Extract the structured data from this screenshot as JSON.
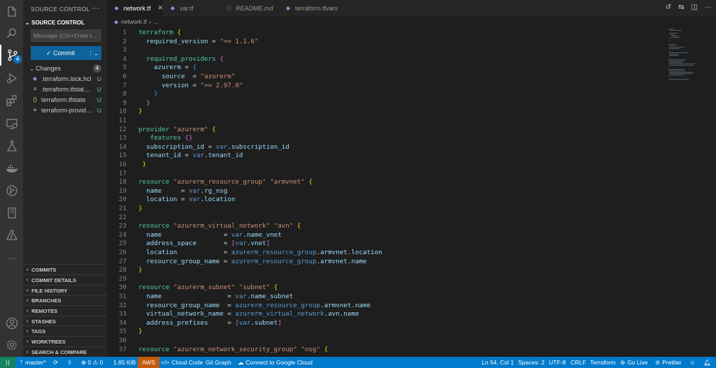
{
  "activity_bar": {
    "items": [
      {
        "name": "explorer",
        "icon": "files-icon"
      },
      {
        "name": "search",
        "icon": "search-icon"
      },
      {
        "name": "source-control",
        "icon": "source-control-icon",
        "badge": "4"
      },
      {
        "name": "run-debug",
        "icon": "run-debug-icon"
      },
      {
        "name": "extensions",
        "icon": "extensions-icon"
      },
      {
        "name": "remote-explorer",
        "icon": "remote-explorer-icon"
      },
      {
        "name": "testing",
        "icon": "flask-icon"
      },
      {
        "name": "docker",
        "icon": "docker-icon"
      },
      {
        "name": "git-graph",
        "icon": "git-graph-icon"
      },
      {
        "name": "notebook",
        "icon": "notebook-icon"
      },
      {
        "name": "azure",
        "icon": "azure-icon"
      },
      {
        "name": "more",
        "icon": "ellipsis-icon"
      }
    ],
    "bottom": [
      {
        "name": "accounts",
        "icon": "account-icon"
      },
      {
        "name": "manage",
        "icon": "gear-icon"
      }
    ]
  },
  "sidebar": {
    "title": "SOURCE CONTROL",
    "section": "SOURCE CONTROL",
    "message_placeholder": "Message (Ctrl+Enter t...",
    "commit_label": "✓ Commit",
    "changes_label": "Changes",
    "changes_count": "4",
    "files": [
      {
        "name": ".terraform.lock.hcl",
        "status": "U",
        "icon": "terraform-icon"
      },
      {
        "name": ".terraform.tfstate.l...",
        "status": "U",
        "icon": "file-icon"
      },
      {
        "name": "terraform.tfstate",
        "status": "U",
        "icon": "json-icon"
      },
      {
        "name": "terraform-provide...",
        "status": "U",
        "icon": "file-icon"
      }
    ],
    "panels": [
      "COMMITS",
      "COMMIT DETAILS",
      "FILE HISTORY",
      "BRANCHES",
      "REMOTES",
      "STASHES",
      "TAGS",
      "WORKTREES",
      "SEARCH & COMPARE"
    ]
  },
  "tabs": [
    {
      "label": "network.tf",
      "active": true,
      "icon": "terraform-icon"
    },
    {
      "label": "var.tf",
      "active": false,
      "icon": "terraform-icon"
    },
    {
      "label": "README.md",
      "active": false,
      "icon": "info-icon"
    },
    {
      "label": "terraform.tfvars",
      "active": false,
      "icon": "terraform-icon"
    }
  ],
  "breadcrumb": {
    "file": "network.tf",
    "rest": "..."
  },
  "editor": {
    "lines": [
      [
        [
          "kw",
          "terraform "
        ],
        [
          "br1",
          "{"
        ]
      ],
      [
        [
          "txt",
          "  "
        ],
        [
          "attr",
          "required_version"
        ],
        [
          "txt",
          " = "
        ],
        [
          "str",
          "\">= 1.1.6\""
        ]
      ],
      [
        [
          "txt",
          ""
        ]
      ],
      [
        [
          "txt",
          "  "
        ],
        [
          "kw",
          "required_providers "
        ],
        [
          "br2",
          "{"
        ]
      ],
      [
        [
          "txt",
          "    "
        ],
        [
          "attr",
          "azurerm"
        ],
        [
          "txt",
          " = "
        ],
        [
          "br3",
          "{"
        ]
      ],
      [
        [
          "txt",
          "      "
        ],
        [
          "attr",
          "source"
        ],
        [
          "txt",
          "  = "
        ],
        [
          "str",
          "\"azurerm\""
        ]
      ],
      [
        [
          "txt",
          "      "
        ],
        [
          "attr",
          "version"
        ],
        [
          "txt",
          " = "
        ],
        [
          "str",
          "\">= 2.97.0\""
        ]
      ],
      [
        [
          "txt",
          "    "
        ],
        [
          "br3",
          "}"
        ]
      ],
      [
        [
          "txt",
          "  "
        ],
        [
          "br2",
          "}"
        ]
      ],
      [
        [
          "br1",
          "}"
        ]
      ],
      [
        [
          "txt",
          ""
        ]
      ],
      [
        [
          "kw",
          "provider "
        ],
        [
          "str",
          "\"azurerm\" "
        ],
        [
          "br1",
          "{"
        ]
      ],
      [
        [
          "txt",
          "   "
        ],
        [
          "kw",
          "features "
        ],
        [
          "br2",
          "{}"
        ]
      ],
      [
        [
          "txt",
          "  "
        ],
        [
          "attr",
          "subscription_id"
        ],
        [
          "txt",
          " = "
        ],
        [
          "var",
          "var"
        ],
        [
          "txt",
          "."
        ],
        [
          "attr",
          "subscription_id"
        ]
      ],
      [
        [
          "txt",
          "  "
        ],
        [
          "attr",
          "tenant_id"
        ],
        [
          "txt",
          " = "
        ],
        [
          "var",
          "var"
        ],
        [
          "txt",
          "."
        ],
        [
          "attr",
          "tenant_id"
        ]
      ],
      [
        [
          "txt",
          " "
        ],
        [
          "br1",
          "}"
        ]
      ],
      [
        [
          "txt",
          ""
        ]
      ],
      [
        [
          "kw",
          "resource "
        ],
        [
          "str",
          "\"azurerm_resource_group\" \"armvnet\" "
        ],
        [
          "br1",
          "{"
        ]
      ],
      [
        [
          "txt",
          "  "
        ],
        [
          "attr",
          "name"
        ],
        [
          "txt",
          "     = "
        ],
        [
          "var",
          "var"
        ],
        [
          "txt",
          "."
        ],
        [
          "attr",
          "rg_nsg"
        ]
      ],
      [
        [
          "txt",
          "  "
        ],
        [
          "attr",
          "location"
        ],
        [
          "txt",
          " = "
        ],
        [
          "var",
          "var"
        ],
        [
          "txt",
          "."
        ],
        [
          "attr",
          "location"
        ]
      ],
      [
        [
          "br1",
          "}"
        ]
      ],
      [
        [
          "txt",
          ""
        ]
      ],
      [
        [
          "kw",
          "resource "
        ],
        [
          "str",
          "\"azurerm_virtual_network\" \"avn\" "
        ],
        [
          "br1",
          "{"
        ]
      ],
      [
        [
          "txt",
          "  "
        ],
        [
          "attr",
          "name"
        ],
        [
          "txt",
          "                = "
        ],
        [
          "var",
          "var"
        ],
        [
          "txt",
          "."
        ],
        [
          "attr",
          "name_vnet"
        ]
      ],
      [
        [
          "txt",
          "  "
        ],
        [
          "attr",
          "address_space"
        ],
        [
          "txt",
          "       = "
        ],
        [
          "br2",
          "["
        ],
        [
          "var",
          "var"
        ],
        [
          "txt",
          "."
        ],
        [
          "attr",
          "vnet"
        ],
        [
          "br2",
          "]"
        ]
      ],
      [
        [
          "txt",
          "  "
        ],
        [
          "attr",
          "location"
        ],
        [
          "txt",
          "            = "
        ],
        [
          "var",
          "azurerm_resource_group"
        ],
        [
          "txt",
          "."
        ],
        [
          "attr",
          "armvnet"
        ],
        [
          "txt",
          "."
        ],
        [
          "attr",
          "location"
        ]
      ],
      [
        [
          "txt",
          "  "
        ],
        [
          "attr",
          "resource_group_name"
        ],
        [
          "txt",
          " = "
        ],
        [
          "var",
          "azurerm_resource_group"
        ],
        [
          "txt",
          "."
        ],
        [
          "attr",
          "armvnet"
        ],
        [
          "txt",
          "."
        ],
        [
          "attr",
          "name"
        ]
      ],
      [
        [
          "br1",
          "}"
        ]
      ],
      [
        [
          "txt",
          ""
        ]
      ],
      [
        [
          "kw",
          "resource "
        ],
        [
          "str",
          "\"azurerm_subnet\" \"subnet\" "
        ],
        [
          "br1",
          "{"
        ]
      ],
      [
        [
          "txt",
          "  "
        ],
        [
          "attr",
          "name"
        ],
        [
          "txt",
          "                 = "
        ],
        [
          "var",
          "var"
        ],
        [
          "txt",
          "."
        ],
        [
          "attr",
          "name_subnet"
        ]
      ],
      [
        [
          "txt",
          "  "
        ],
        [
          "attr",
          "resource_group_name"
        ],
        [
          "txt",
          "  = "
        ],
        [
          "var",
          "azurerm_resource_group"
        ],
        [
          "txt",
          "."
        ],
        [
          "attr",
          "armvnet"
        ],
        [
          "txt",
          "."
        ],
        [
          "attr",
          "name"
        ]
      ],
      [
        [
          "txt",
          "  "
        ],
        [
          "attr",
          "virtual_network_name"
        ],
        [
          "txt",
          " = "
        ],
        [
          "var",
          "azurerm_virtual_network"
        ],
        [
          "txt",
          "."
        ],
        [
          "attr",
          "avn"
        ],
        [
          "txt",
          "."
        ],
        [
          "attr",
          "name"
        ]
      ],
      [
        [
          "txt",
          "  "
        ],
        [
          "attr",
          "address_prefixes"
        ],
        [
          "txt",
          "     = "
        ],
        [
          "br2",
          "["
        ],
        [
          "var",
          "var"
        ],
        [
          "txt",
          "."
        ],
        [
          "attr",
          "subnet"
        ],
        [
          "br2",
          "]"
        ]
      ],
      [
        [
          "br1",
          "}"
        ]
      ],
      [
        [
          "txt",
          ""
        ]
      ],
      [
        [
          "kw",
          "resource "
        ],
        [
          "str",
          "\"azurerm_network_security_group\" \"nsg\" "
        ],
        [
          "br1",
          "{"
        ]
      ]
    ]
  },
  "status_bar": {
    "branch": "master*",
    "errors": "⊗ 0 ⚠ 0",
    "size": "1.65 KiB",
    "aws": "AWS",
    "cloud_code": "Cloud Code",
    "git_graph": "Git Graph",
    "google_cloud": "Connect to Google Cloud",
    "position": "Ln 54, Col 1",
    "spaces": "Spaces: 2",
    "encoding": "UTF-8",
    "eol": "CRLF",
    "language": "Terraform",
    "go_live": "Go Live",
    "prettier": "Prettier"
  },
  "colors": {
    "accent": "#007acc",
    "activity_bg": "#333333",
    "sidebar_bg": "#252526",
    "editor_bg": "#1e1e1e"
  }
}
